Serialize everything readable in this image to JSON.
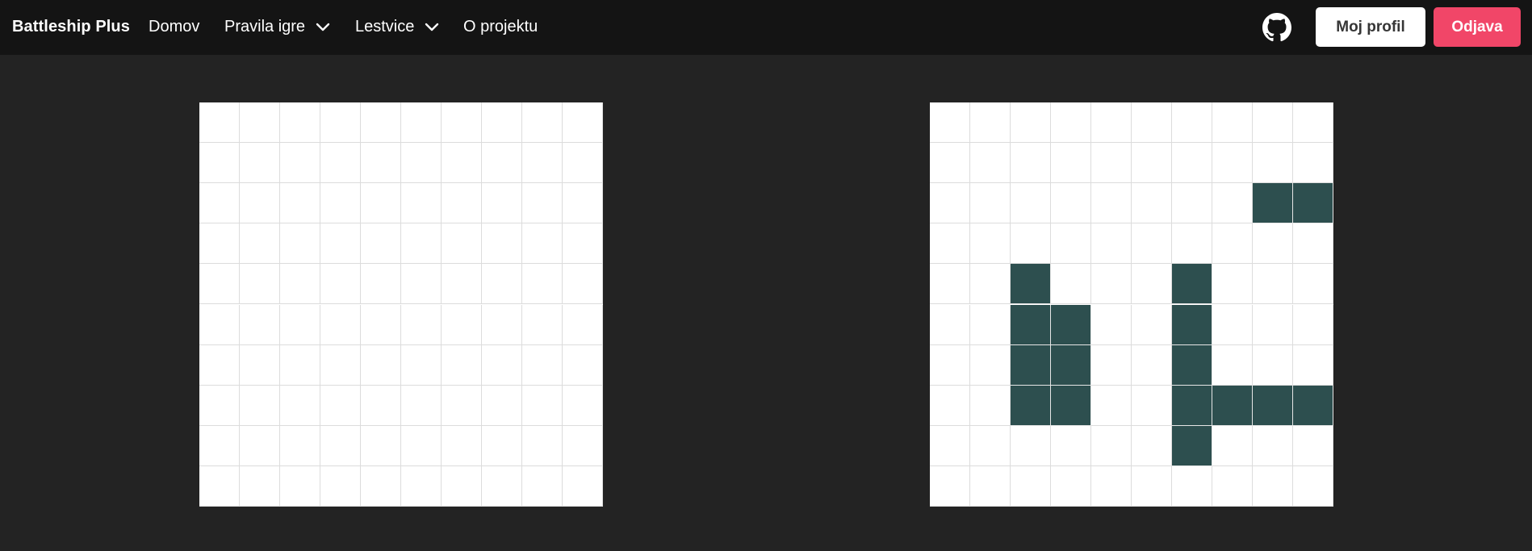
{
  "nav": {
    "brand": "Battleship Plus",
    "home": "Domov",
    "rules": "Pravila igre",
    "leaderboards": "Lestvice",
    "about": "O projektu",
    "github_icon": "github-icon",
    "profile_button": "Moj profil",
    "logout_button": "Odjava"
  },
  "colors": {
    "navbar_bg": "#141414",
    "page_bg": "#232323",
    "ship": "#2d4f4f",
    "logout_bg": "#f14668",
    "grid_line": "#dcdcdc"
  },
  "boards": {
    "size": 10,
    "opponent": {
      "ship_cells": []
    },
    "player": {
      "ship_cells": [
        [
          2,
          8
        ],
        [
          2,
          9
        ],
        [
          4,
          2
        ],
        [
          5,
          2
        ],
        [
          6,
          2
        ],
        [
          7,
          2
        ],
        [
          5,
          3
        ],
        [
          6,
          3
        ],
        [
          7,
          3
        ],
        [
          4,
          6
        ],
        [
          5,
          6
        ],
        [
          6,
          6
        ],
        [
          7,
          6
        ],
        [
          8,
          6
        ],
        [
          7,
          7
        ],
        [
          7,
          8
        ],
        [
          7,
          9
        ]
      ]
    }
  }
}
